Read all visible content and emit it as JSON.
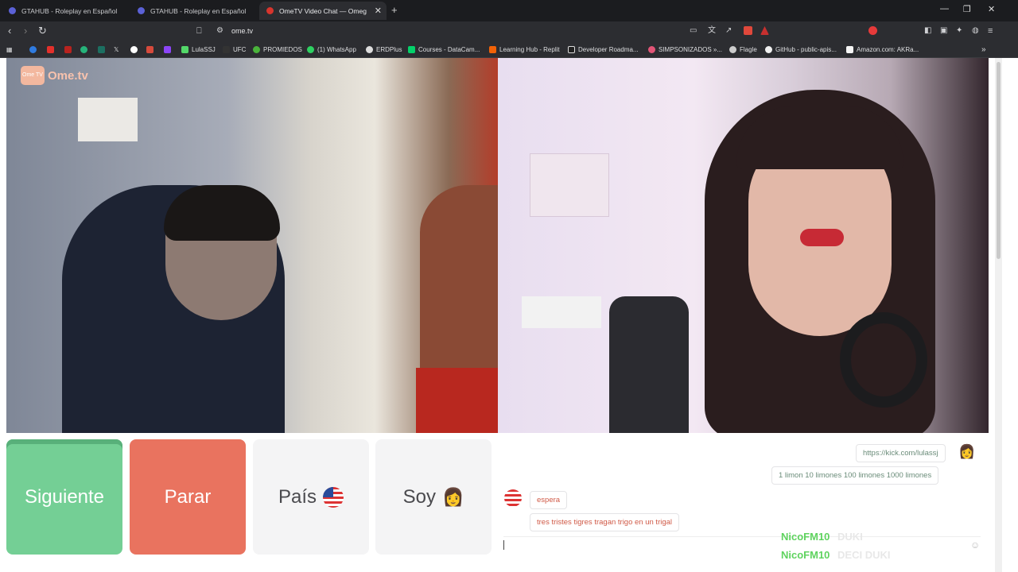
{
  "tabs": [
    {
      "title": "GTAHUB - Roleplay en Español"
    },
    {
      "title": "GTAHUB - Roleplay en Español"
    },
    {
      "title": "OmeTV Video Chat — Omeg"
    }
  ],
  "address": {
    "url": "ome.tv"
  },
  "bookmarks": [
    "LulaSSJ",
    "UFC",
    "PROMIEDOS",
    "(1) WhatsApp",
    "ERDPlus",
    "Courses - DataCam...",
    "Learning Hub - Replit",
    "Developer Roadma...",
    "SIMPSONIZADOS »...",
    "Flagle",
    "GitHub - public-apis...",
    "Amazon.com: AKRa..."
  ],
  "logo": {
    "badge": "Ome TV",
    "word": "Ome.tv"
  },
  "buttons": {
    "next": "Siguiente",
    "stop": "Parar",
    "country": "País",
    "me": "Soy"
  },
  "chat": {
    "messages": [
      {
        "side": "mine",
        "text": "https://kick.com/lulassj"
      },
      {
        "side": "mine",
        "text": "1 limon 10 limones 100 limones 1000 limones"
      },
      {
        "side": "theirs",
        "text": "espera"
      },
      {
        "side": "theirs",
        "text": "tres tristes tigres tragan trigo en un trigal"
      }
    ]
  },
  "overlay": [
    {
      "user": "NicoFM10",
      "msg": "DUKI"
    },
    {
      "user": "NicoFM10",
      "msg": "DECI DUKI"
    }
  ],
  "colors": {
    "next": "#74cf95",
    "stop": "#e9735f",
    "accent": "#5b61d6"
  }
}
